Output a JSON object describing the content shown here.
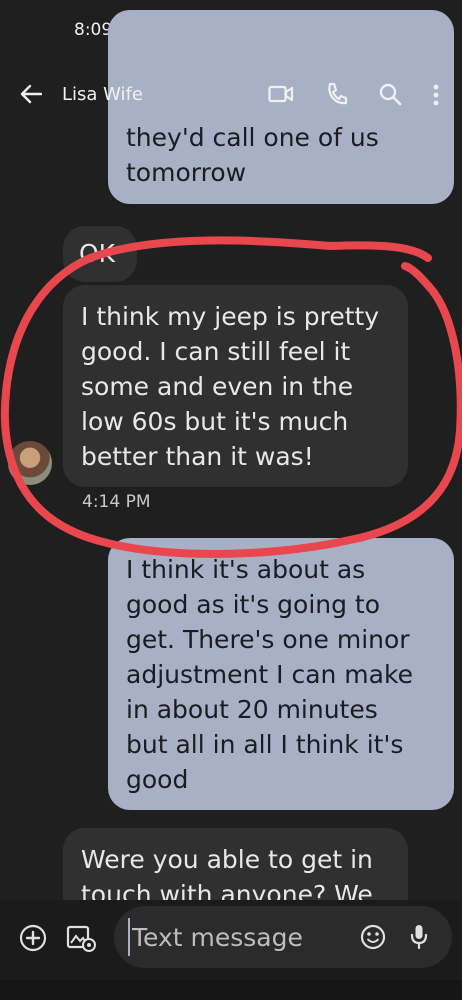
{
  "status": {
    "time": "8:09"
  },
  "header": {
    "contact_name": "Lisa Wife"
  },
  "messages": [
    {
      "direction": "outgoing",
      "text": "they'd call one of us tomorrow",
      "lines": [
        "they'd call one of us",
        "tomorrow"
      ]
    },
    {
      "direction": "incoming",
      "text": "OK"
    },
    {
      "direction": "incoming",
      "text": "I think my jeep is pretty good. I can still feel it some and even in the low 60s but it's much better than it was!",
      "lines": [
        "I think my jeep is pretty",
        "good. I can still feel it",
        "some and even in the",
        "low 60s but it's much",
        "better than it was!"
      ],
      "timestamp": "4:14 PM"
    },
    {
      "direction": "outgoing",
      "text": "I think it's about as good as it's going to get. There's one minor adjustment I can make in about 20 minutes but all in all I think it's good",
      "lines": [
        "I think it's about as",
        "good as it's going to",
        "get. There's one minor",
        "adjustment I can make",
        "in about 20 minutes",
        "but all in all I think it's",
        "good"
      ]
    },
    {
      "direction": "incoming",
      "text": "Were you able to get in touch with anyone? We",
      "lines": [
        "Were you able to get in",
        "touch with anyone? We"
      ]
    }
  ],
  "composer": {
    "placeholder": "Text message"
  },
  "colors": {
    "background": "#1f1f1f",
    "outgoing_bubble": "#a8b0c6",
    "incoming_bubble": "#303030",
    "annotation": "#e8474e"
  }
}
